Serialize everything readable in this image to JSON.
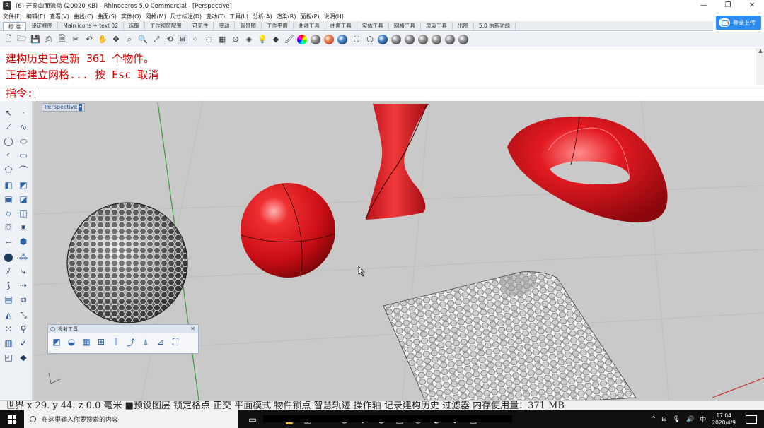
{
  "window": {
    "title": "(6)  开窗曲面流动 (20020 KB) - Rhinoceros 5.0 Commercial - [Perspective]",
    "controls": [
      "—",
      "❐",
      "✕"
    ]
  },
  "menu": [
    "文件(F)",
    "编辑(E)",
    "查看(V)",
    "曲线(C)",
    "曲面(S)",
    "实体(O)",
    "网格(M)",
    "尺寸标注(D)",
    "变动(T)",
    "工具(L)",
    "分析(A)",
    "渲染(R)",
    "面板(P)",
    "说明(H)"
  ],
  "tabs": [
    "标 准",
    "设定视图",
    "Main icons + text 02",
    "选取",
    "工作视窗配置",
    "可见性",
    "变动",
    "背景图",
    "工作平面",
    "曲线工具",
    "曲面工具",
    "实体工具",
    "网格工具",
    "渲染工具",
    "出图",
    "5.0 的新功能"
  ],
  "login_button": "登录上传",
  "toolbar_icons": [
    "new-file",
    "open-folder",
    "save",
    "print",
    "import",
    "cut",
    "undo",
    "pan",
    "move",
    "zoom",
    "zoom-window",
    "zoom-extents",
    "zoom-selected",
    "rotate",
    "four-viewports",
    "point-cloud",
    "select-lasso",
    "grid",
    "object-snap",
    "layer",
    "light",
    "render-material",
    "paint",
    "color-wheel",
    "render-ball",
    "cplane",
    "environment",
    "clipping",
    "mesh-tools",
    "help",
    "display-wireframe",
    "display-shaded",
    "display-rendered",
    "display-ghosted",
    "display-xray",
    "display-technical"
  ],
  "command_history": [
    "建构历史已更新 361 个物件。",
    "正在建立网格... 按 Esc 取消"
  ],
  "command_prompt": "指令:",
  "viewport": {
    "label": "Perspective",
    "dropdown": "▾"
  },
  "floating_toolbar": {
    "title": "投射工具",
    "close": "✕"
  },
  "status_bar": "世界  x 29. y 44. z 0.0  毫米  ■预设图层   锁定格点  正交  平面模式  物件锁点  智慧轨迹  操作轴  记录建构历史  过滤器  内存使用量：371 MB",
  "taskbar": {
    "search_placeholder": "在这里输入你要搜索的内容",
    "time": "17:04",
    "date": "2020/4/9",
    "ime": "中"
  },
  "colors": {
    "command_text": "#d40000",
    "viewport_bg": "#c9c9c9",
    "object_red": "#d8141b",
    "axis_green": "#3c9a3c",
    "taskbar_bg": "#101010"
  }
}
